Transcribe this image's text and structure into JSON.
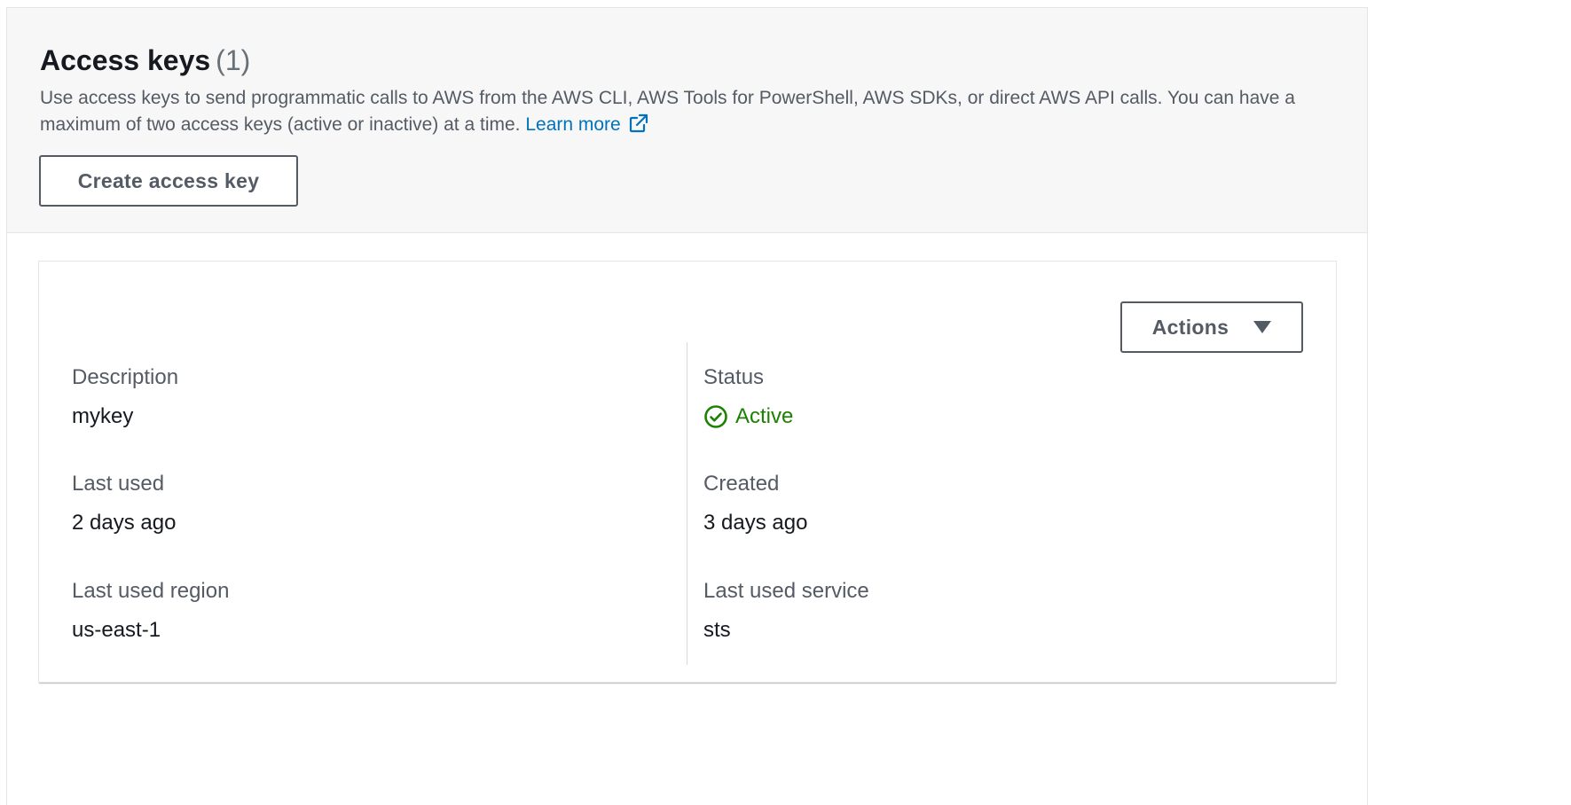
{
  "access_keys": {
    "title": "Access keys",
    "count": "(1)",
    "description": "Use access keys to send programmatic calls to AWS from the AWS CLI, AWS Tools for PowerShell, AWS SDKs, or direct AWS API calls. You can have a maximum of two access keys (active or inactive) at a time.",
    "learn_more_label": "Learn more",
    "learn_more_icon": "external-link-icon",
    "create_button_label": "Create access key"
  },
  "key_card": {
    "actions_label": "Actions",
    "actions_icon": "caret-down-icon",
    "fields": {
      "description": {
        "label": "Description",
        "value": "mykey"
      },
      "status": {
        "label": "Status",
        "value": "Active",
        "icon": "check-circle-icon",
        "color": "#1d8102"
      },
      "last_used": {
        "label": "Last used",
        "value": "2 days ago"
      },
      "created": {
        "label": "Created",
        "value": "3 days ago"
      },
      "last_used_region": {
        "label": "Last used region",
        "value": "us-east-1"
      },
      "last_used_service": {
        "label": "Last used service",
        "value": "sts"
      }
    }
  },
  "colors": {
    "header_background": "#f7f7f7",
    "link": "#0073bb",
    "button_border": "#545b64",
    "status_active": "#1d8102"
  }
}
